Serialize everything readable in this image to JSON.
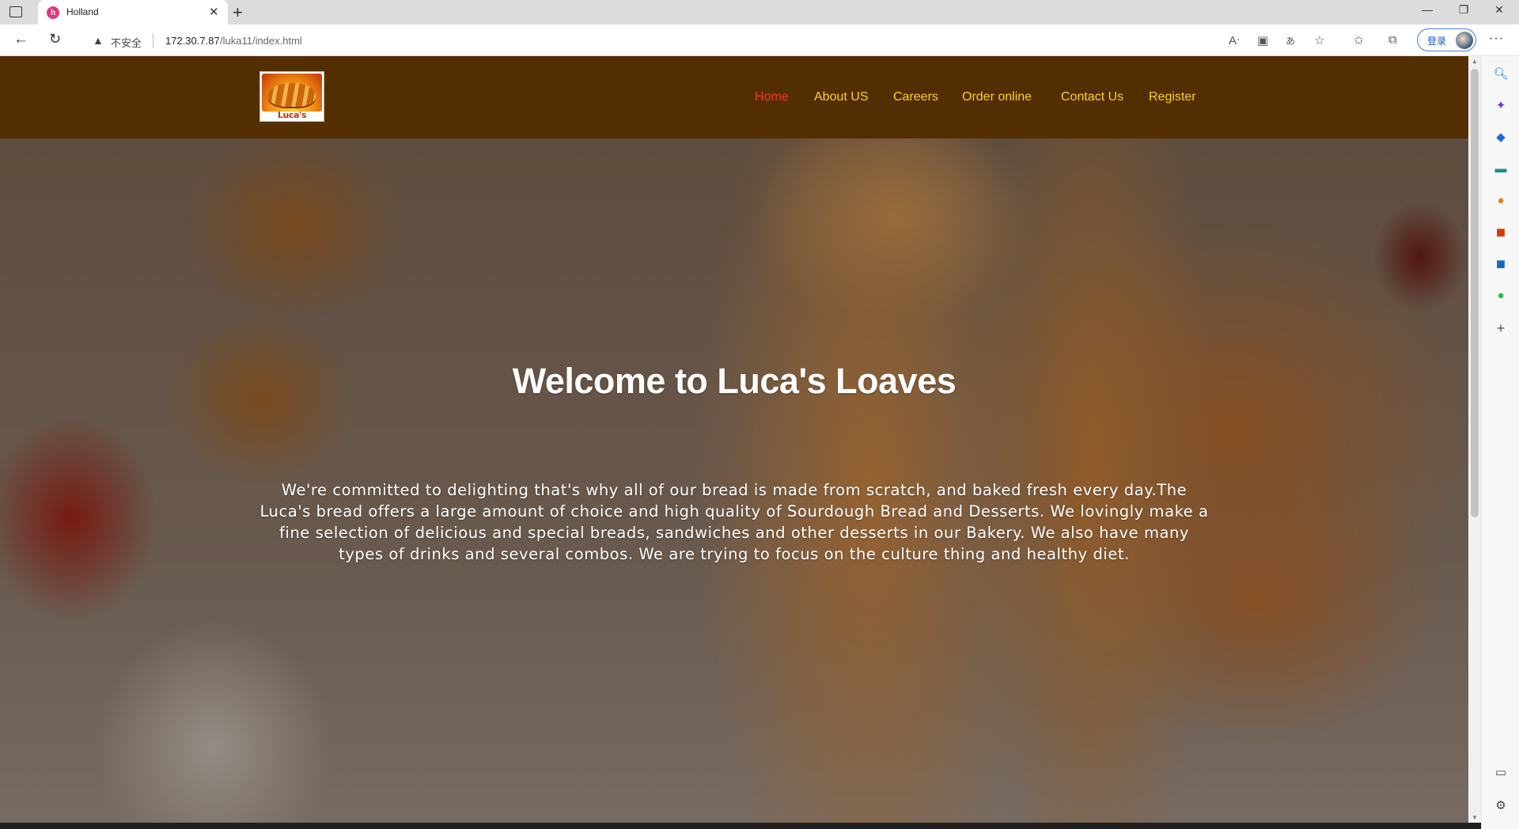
{
  "browser": {
    "tab_title": "Holland",
    "favicon_letter": "h",
    "address": {
      "security_label": "不安全",
      "host": "172.30.7.87",
      "path": "/luka11/index.html"
    },
    "login_label": "登录"
  },
  "site": {
    "logo_text": "Luca's Loaves",
    "nav": [
      {
        "label": "Home",
        "active": true
      },
      {
        "label": "About US",
        "active": false
      },
      {
        "label": "Careers",
        "active": false
      },
      {
        "label": "Order online",
        "active": false
      },
      {
        "label": "Contact Us",
        "active": false
      },
      {
        "label": "Register",
        "active": false
      }
    ],
    "colors": {
      "header_bg": "#532e01",
      "nav_text": "#f5d12a",
      "nav_active": "#ef3f2b"
    }
  },
  "hero": {
    "title": "Welcome to Luca's Loaves",
    "text": "We're committed to delighting that's why all of our bread is made from scratch, and baked fresh every day.The Luca's bread offers a large amount of choice and high quality of Sourdough Bread and Desserts. We lovingly make a fine selection of delicious and special breads, sandwiches and other desserts in our Bakery. We also have many types of drinks and several combos. We are trying to focus on the culture thing and healthy diet."
  },
  "icons": {
    "sidebar": [
      "search-icon",
      "copilot-icon",
      "tag-icon",
      "toolbox-icon",
      "games-icon",
      "office-icon",
      "outlook-icon",
      "spotify-icon",
      "add-icon",
      "split-screen-icon",
      "settings-icon"
    ],
    "address_bar": [
      "read-aloud-icon",
      "immersive-reader-icon",
      "translate-icon",
      "add-favorite-icon",
      "favorites-icon",
      "collections-icon",
      "more-icon"
    ]
  }
}
